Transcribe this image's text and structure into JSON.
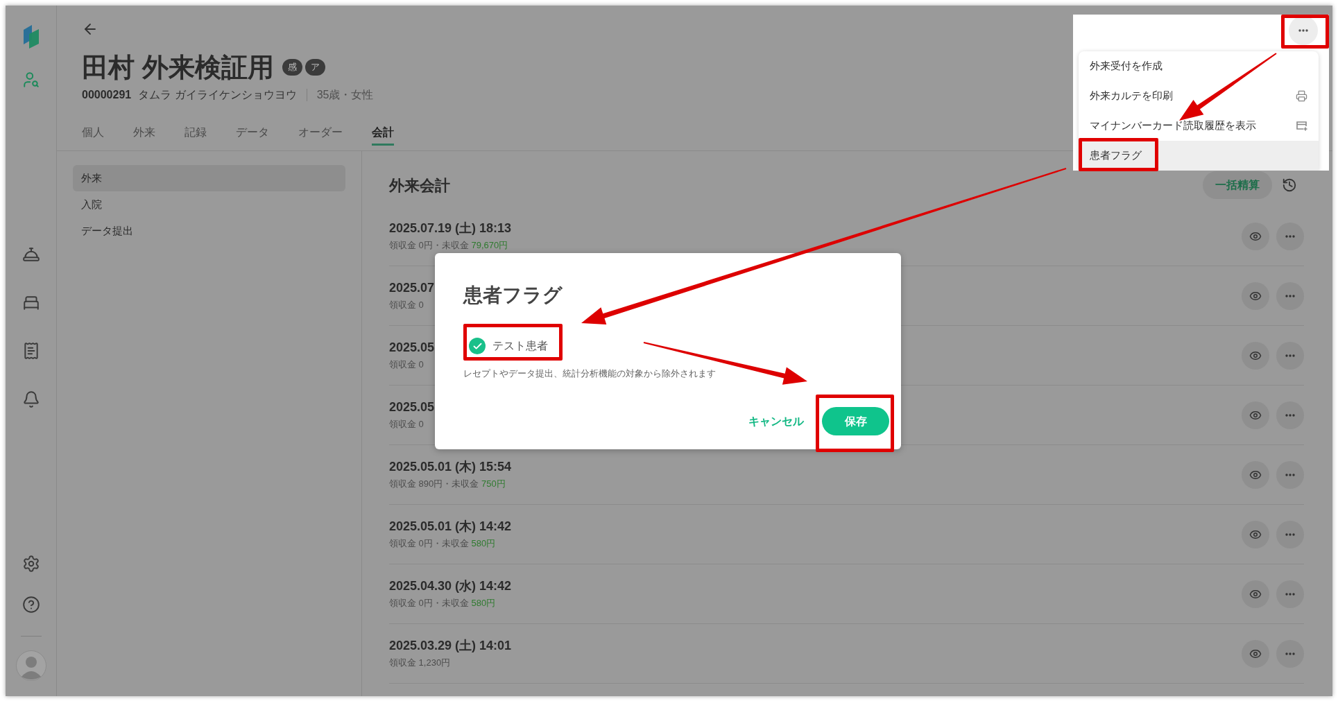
{
  "sidebar": {
    "items": [
      {
        "kind": "patient-search",
        "selected": true
      },
      {
        "kind": "reception",
        "selected": false
      },
      {
        "kind": "ward",
        "selected": false
      },
      {
        "kind": "billing",
        "selected": false
      },
      {
        "kind": "notifications",
        "selected": false
      }
    ]
  },
  "patient": {
    "name": "田村 外来検証用",
    "badges": [
      "感",
      "ア"
    ],
    "id": "00000291",
    "kana": "タムラ ガイライケンショウヨウ",
    "age_sex": "35歳・女性"
  },
  "tabs": [
    {
      "label": "個人",
      "selected": false
    },
    {
      "label": "外来",
      "selected": false
    },
    {
      "label": "記録",
      "selected": false
    },
    {
      "label": "データ",
      "selected": false
    },
    {
      "label": "オーダー",
      "selected": false
    },
    {
      "label": "会計",
      "selected": true
    }
  ],
  "side_nav": [
    {
      "label": "外来",
      "selected": true
    },
    {
      "label": "入院",
      "selected": false
    },
    {
      "label": "データ提出",
      "selected": false
    }
  ],
  "billing": {
    "title": "外来会計",
    "settle_all_button": "一括精算",
    "rows": [
      {
        "date": "2025.07.19 (土) 18:13",
        "received": "領収金 0円",
        "separator": "・",
        "unpaid_label": "未収金",
        "unpaid": "79,670円"
      },
      {
        "date": "2025.07",
        "received": "領収金 0"
      },
      {
        "date": "2025.05",
        "received": "領収金 0"
      },
      {
        "date": "2025.05",
        "received": "領収金 0"
      },
      {
        "date": "2025.05.01 (木) 15:54",
        "received": "領収金 890円",
        "separator": "・",
        "unpaid_label": "未収金",
        "unpaid": "750円"
      },
      {
        "date": "2025.05.01 (木) 14:42",
        "received": "領収金 0円",
        "separator": "・",
        "unpaid_label": "未収金",
        "unpaid": "580円"
      },
      {
        "date": "2025.04.30 (水) 14:42",
        "received": "領収金 0円",
        "separator": "・",
        "unpaid_label": "未収金",
        "unpaid": "580円"
      },
      {
        "date": "2025.03.29 (土) 14:01",
        "received": "領収金 1,230円"
      }
    ]
  },
  "menu": {
    "items": [
      {
        "label": "外来受付を作成",
        "highlighted": false
      },
      {
        "label": "外来カルテを印刷",
        "kind": "print",
        "highlighted": false
      },
      {
        "label": "マイナンバーカード読取履歴を表示",
        "kind": "card-history",
        "highlighted": false
      },
      {
        "label": "患者フラグ",
        "highlighted": true
      }
    ]
  },
  "dialog": {
    "title": "患者フラグ",
    "option": {
      "label": "テスト患者",
      "checked": true
    },
    "note": "レセプトやデータ提出、統計分析機能の対象から除外されます",
    "cancel": "キャンセル",
    "save": "保存"
  }
}
